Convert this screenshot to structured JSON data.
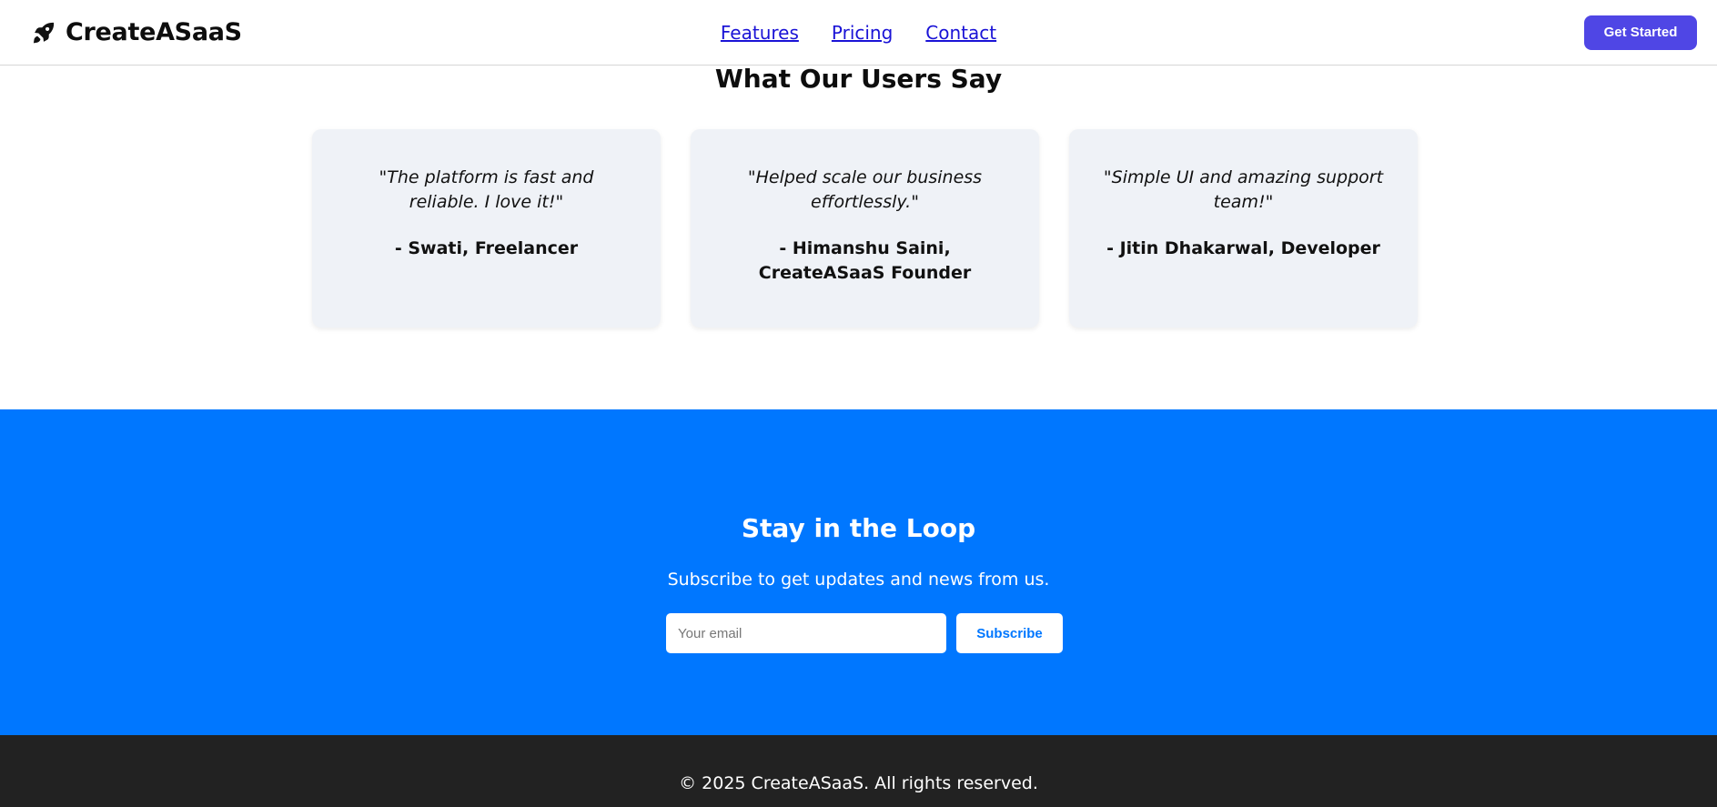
{
  "navbar": {
    "brand_icon": "rocket-icon",
    "brand_name": "CreateASaaS",
    "links": [
      {
        "label": "Features"
      },
      {
        "label": "Pricing"
      },
      {
        "label": "Contact"
      }
    ],
    "cta_label": "Get Started",
    "cta_color": "#4f46e5"
  },
  "testimonials": {
    "title": "What Our Users Say",
    "cards": [
      {
        "quote": "\"The platform is fast and reliable. I love it!\"",
        "author": "- Swati, Freelancer"
      },
      {
        "quote": "\"Helped scale our business effortlessly.\"",
        "author": "- Himanshu Saini, CreateASaaS Founder"
      },
      {
        "quote": "\"Simple UI and amazing support team!\"",
        "author": "- Jitin Dhakarwal, Developer"
      }
    ]
  },
  "newsletter": {
    "title": "Stay in the Loop",
    "subtitle": "Subscribe to get updates and news from us.",
    "email_placeholder": "Your email",
    "email_value": "",
    "button_label": "Subscribe",
    "background_color": "#0077ff"
  },
  "footer": {
    "text": "© 2025 CreateASaaS. All rights reserved.",
    "background_color": "#222222"
  }
}
